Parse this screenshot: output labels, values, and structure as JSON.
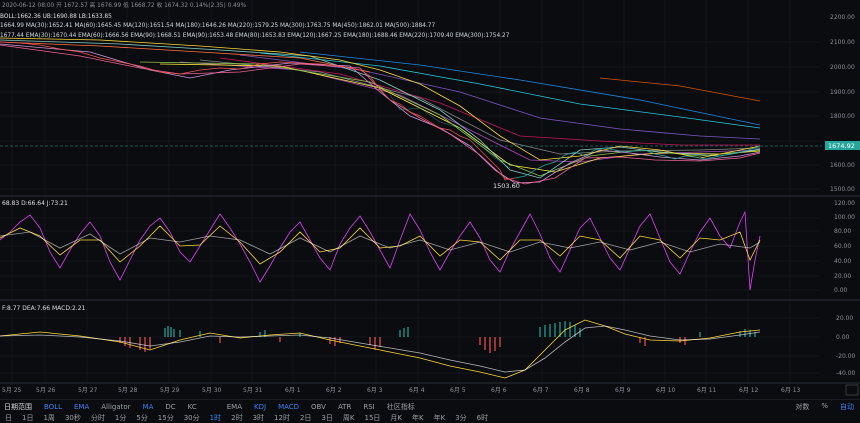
{
  "header": {
    "line1": "2020-06-12 08:00  开 1672.57  高 1676.99  低 1668.72  收 1674.32  0.14%(2.35)  0.49%",
    "boll": "BOLL:1662.36  UB:1690.88  LB:1633.85",
    "ma": "1664.99  MA(30):1652.41  MA(60):1645.45  MA(120):1651.54  MA(180):1646.26  MA(220):1579.25  MA(300):1763.75  MA(450):1862.01  MA(500):1884.77",
    "ema": "1677.44  EMA(30):1670.44  EMA(60):1666.56  EMA(90):1668.51  EMA(90):1653.48  EMA(80):1653.83  EMA(120):1667.25  EMA(180):1688.46  EMA(220):1709.40  EMA(300):1754.27"
  },
  "kdj_header": "68.83  D:66.64  J:73.21",
  "macd_header": "F:8.77  DEA:7.66  MACD:2.21",
  "price_axis": [
    "2200.00",
    "2100.00",
    "2000.00",
    "1900.00",
    "1800.00",
    "1700.00",
    "1600.00",
    "1500.00"
  ],
  "current_price": "1674.92",
  "low_marker": "1503.60",
  "kdj_axis": [
    "120.00",
    "100.00",
    "80.00",
    "60.00",
    "40.00",
    "20.00",
    "0.00"
  ],
  "macd_axis": [
    "20.00",
    "0.00",
    "-20.00",
    "-40.00"
  ],
  "x_axis": [
    "5月 25",
    "5月 26",
    "5月 27",
    "5月 28",
    "5月 29",
    "5月 30",
    "5月 31",
    "6月 1",
    "6月 2",
    "6月 3",
    "6月 4",
    "6月 5",
    "6月 6",
    "6月 7",
    "6月 8",
    "6月 9",
    "6月 10",
    "6月 11",
    "6月 12",
    "6月 13"
  ],
  "toolbar": {
    "range": "日期范围",
    "indicators": [
      "BOLL",
      "EMA",
      "Alligator",
      "MA",
      "DC",
      "KC",
      "EMA",
      "KDJ",
      "MACD",
      "OBV",
      "ATR",
      "RSI",
      "社区指标"
    ],
    "right": [
      "对数",
      "%",
      "自动"
    ]
  },
  "periods": [
    "日",
    "1日",
    "1周",
    "30秒",
    "分时",
    "1分",
    "5分",
    "15分",
    "30分",
    "1时",
    "2时",
    "3时",
    "12时",
    "2日",
    "3日",
    "周K",
    "15日",
    "月K",
    "年K",
    "年K",
    "3分",
    "6时"
  ],
  "colors": {
    "up": "#26a69a",
    "down": "#ef5350",
    "accent": "#3b82f6",
    "bg": "#0b0c10"
  }
}
